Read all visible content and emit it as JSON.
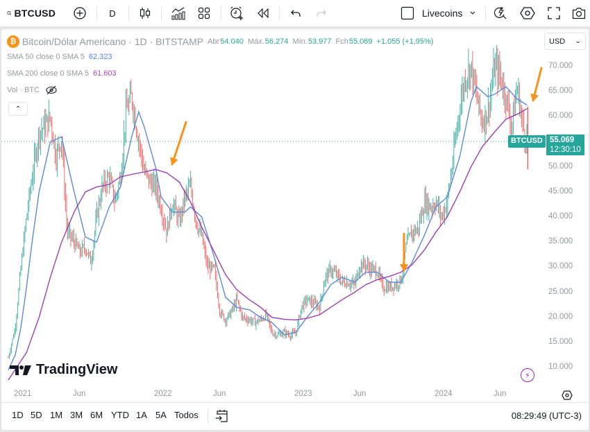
{
  "topbar": {
    "symbol": "BTCUSD",
    "interval": "D",
    "layout_name": "Livecoins",
    "icons": [
      "search-icon",
      "add-symbol-icon",
      "candles-icon",
      "indicators-icon",
      "templates-icon",
      "alert-icon",
      "replay-icon",
      "undo-icon",
      "redo-icon",
      "layout-square-icon",
      "chevron-down-icon",
      "quick-search-icon",
      "settings-icon",
      "fullscreen-icon",
      "camera-icon"
    ]
  },
  "legend": {
    "coin_glyph": "₿",
    "title": "Bitcoin/Dólar Americano · 1D · BITSTAMP",
    "open_label": "Abr",
    "open": "54.040",
    "high_label": "Máx.",
    "high": "56.274",
    "low_label": "Mín.",
    "low": "53.977",
    "close_label": "Fch",
    "close": "55.069",
    "change": "+1.055 (+1,95%)",
    "sma50_label": "SMA 50 close 0 SMA 5",
    "sma50_value": "62.323",
    "sma200_label": "SMA 200 close 0 SMA 5",
    "sma200_value": "61.603",
    "vol_label": "Vol · BTC",
    "collapse_glyph": "⌃"
  },
  "currency": {
    "label": "USD",
    "chevron": "⌄"
  },
  "price_tag": {
    "symbol": "BTCUSD",
    "price": "55.069",
    "countdown": "12:30:10"
  },
  "brand": {
    "name": "TradingView"
  },
  "bottombar": {
    "ranges": [
      "1D",
      "5D",
      "1M",
      "3M",
      "6M",
      "YTD",
      "1A",
      "5A",
      "Todos"
    ],
    "clock": "08:29:49 (UTC-3)"
  },
  "colors": {
    "up": "#26a69a",
    "down": "#ef5350",
    "sma50": "#5b8ad6",
    "sma200": "#9c3fb0",
    "arrow": "#f7931a",
    "price_line": "#26a69a"
  },
  "chart_data": {
    "type": "candlestick",
    "title": "Bitcoin/Dólar Americano · 1D · BITSTAMP",
    "y_ticks": [
      "70.000",
      "65.000",
      "60.000",
      "55.000",
      "50.000",
      "45.000",
      "40.000",
      "35.000",
      "30.000",
      "25.000",
      "20.000",
      "15.000",
      "10.000"
    ],
    "ylim": [
      8000,
      74000
    ],
    "x_ticks": [
      "2021",
      "Jun",
      "2022",
      "Jun",
      "2023",
      "Jun",
      "2024",
      "Jun"
    ],
    "x_tick_dates": [
      2021.0,
      2021.42,
      2022.0,
      2022.42,
      2023.0,
      2023.42,
      2024.0,
      2024.42
    ],
    "xlim": [
      2020.95,
      2024.72
    ],
    "current_price": 55069,
    "price_series": [
      [
        2020.95,
        12000
      ],
      [
        2021.0,
        18000
      ],
      [
        2021.04,
        30000
      ],
      [
        2021.08,
        40000
      ],
      [
        2021.12,
        48000
      ],
      [
        2021.17,
        57000
      ],
      [
        2021.21,
        58000
      ],
      [
        2021.25,
        60000
      ],
      [
        2021.29,
        52000
      ],
      [
        2021.33,
        56000
      ],
      [
        2021.37,
        37000
      ],
      [
        2021.42,
        35000
      ],
      [
        2021.46,
        33000
      ],
      [
        2021.5,
        34000
      ],
      [
        2021.54,
        31000
      ],
      [
        2021.58,
        40000
      ],
      [
        2021.62,
        46000
      ],
      [
        2021.67,
        48000
      ],
      [
        2021.71,
        43000
      ],
      [
        2021.75,
        48000
      ],
      [
        2021.79,
        61000
      ],
      [
        2021.83,
        64000
      ],
      [
        2021.87,
        57000
      ],
      [
        2021.92,
        49000
      ],
      [
        2021.96,
        47000
      ],
      [
        2022.0,
        46000
      ],
      [
        2022.04,
        42000
      ],
      [
        2022.08,
        37000
      ],
      [
        2022.12,
        43000
      ],
      [
        2022.17,
        39000
      ],
      [
        2022.21,
        44000
      ],
      [
        2022.25,
        46000
      ],
      [
        2022.29,
        39000
      ],
      [
        2022.33,
        36000
      ],
      [
        2022.37,
        30000
      ],
      [
        2022.42,
        29500
      ],
      [
        2022.46,
        21000
      ],
      [
        2022.5,
        19500
      ],
      [
        2022.54,
        21000
      ],
      [
        2022.58,
        23500
      ],
      [
        2022.62,
        20000
      ],
      [
        2022.67,
        19500
      ],
      [
        2022.71,
        19000
      ],
      [
        2022.75,
        19500
      ],
      [
        2022.79,
        20500
      ],
      [
        2022.83,
        17000
      ],
      [
        2022.87,
        16500
      ],
      [
        2022.92,
        17000
      ],
      [
        2022.96,
        16500
      ],
      [
        2023.0,
        16800
      ],
      [
        2023.04,
        22000
      ],
      [
        2023.08,
        23500
      ],
      [
        2023.12,
        23000
      ],
      [
        2023.17,
        22000
      ],
      [
        2023.21,
        28000
      ],
      [
        2023.25,
        29500
      ],
      [
        2023.29,
        28500
      ],
      [
        2023.33,
        27000
      ],
      [
        2023.37,
        27000
      ],
      [
        2023.42,
        26500
      ],
      [
        2023.46,
        30500
      ],
      [
        2023.5,
        30500
      ],
      [
        2023.54,
        29500
      ],
      [
        2023.58,
        29300
      ],
      [
        2023.62,
        26000
      ],
      [
        2023.67,
        26000
      ],
      [
        2023.71,
        26500
      ],
      [
        2023.75,
        27500
      ],
      [
        2023.79,
        34500
      ],
      [
        2023.83,
        37000
      ],
      [
        2023.87,
        37500
      ],
      [
        2023.92,
        43000
      ],
      [
        2023.96,
        42000
      ],
      [
        2024.0,
        43000
      ],
      [
        2024.04,
        40000
      ],
      [
        2024.08,
        43000
      ],
      [
        2024.12,
        51000
      ],
      [
        2024.17,
        62000
      ],
      [
        2024.21,
        68000
      ],
      [
        2024.25,
        70000
      ],
      [
        2024.29,
        64000
      ],
      [
        2024.33,
        59000
      ],
      [
        2024.37,
        61000
      ],
      [
        2024.42,
        70000
      ],
      [
        2024.46,
        68000
      ],
      [
        2024.5,
        64000
      ],
      [
        2024.54,
        58000
      ],
      [
        2024.58,
        66000
      ],
      [
        2024.62,
        58000
      ],
      [
        2024.65,
        55069
      ]
    ],
    "series": [
      {
        "name": "SMA 50",
        "last_value": 62323,
        "points": [
          [
            2020.95,
            9500
          ],
          [
            2021.0,
            12500
          ],
          [
            2021.04,
            18000
          ],
          [
            2021.08,
            26000
          ],
          [
            2021.12,
            35000
          ],
          [
            2021.17,
            45000
          ],
          [
            2021.25,
            55000
          ],
          [
            2021.33,
            56000
          ],
          [
            2021.42,
            45000
          ],
          [
            2021.5,
            36000
          ],
          [
            2021.58,
            35000
          ],
          [
            2021.67,
            42000
          ],
          [
            2021.75,
            46000
          ],
          [
            2021.83,
            56000
          ],
          [
            2021.88,
            61000
          ],
          [
            2021.92,
            58000
          ],
          [
            2022.0,
            50000
          ],
          [
            2022.04,
            44000
          ],
          [
            2022.12,
            41000
          ],
          [
            2022.21,
            41000
          ],
          [
            2022.25,
            42000
          ],
          [
            2022.33,
            40000
          ],
          [
            2022.42,
            32000
          ],
          [
            2022.5,
            24000
          ],
          [
            2022.58,
            22000
          ],
          [
            2022.67,
            21500
          ],
          [
            2022.75,
            20000
          ],
          [
            2022.83,
            19000
          ],
          [
            2022.92,
            16500
          ],
          [
            2023.0,
            17000
          ],
          [
            2023.08,
            20000
          ],
          [
            2023.17,
            23000
          ],
          [
            2023.25,
            26500
          ],
          [
            2023.33,
            28000
          ],
          [
            2023.42,
            27000
          ],
          [
            2023.5,
            29000
          ],
          [
            2023.58,
            29000
          ],
          [
            2023.67,
            27000
          ],
          [
            2023.75,
            27000
          ],
          [
            2023.83,
            31000
          ],
          [
            2023.92,
            36500
          ],
          [
            2024.0,
            42000
          ],
          [
            2024.08,
            44000
          ],
          [
            2024.17,
            52000
          ],
          [
            2024.25,
            63000
          ],
          [
            2024.29,
            66000
          ],
          [
            2024.37,
            64000
          ],
          [
            2024.42,
            64500
          ],
          [
            2024.5,
            66000
          ],
          [
            2024.58,
            63500
          ],
          [
            2024.65,
            62323
          ]
        ]
      },
      {
        "name": "SMA 200",
        "last_value": 61603,
        "points": [
          [
            2020.95,
            7500
          ],
          [
            2021.08,
            13000
          ],
          [
            2021.17,
            20000
          ],
          [
            2021.25,
            28000
          ],
          [
            2021.33,
            35000
          ],
          [
            2021.42,
            41000
          ],
          [
            2021.5,
            45000
          ],
          [
            2021.58,
            46000
          ],
          [
            2021.67,
            46500
          ],
          [
            2021.75,
            48000
          ],
          [
            2021.83,
            48500
          ],
          [
            2021.92,
            49000
          ],
          [
            2022.0,
            49500
          ],
          [
            2022.08,
            48800
          ],
          [
            2022.17,
            47000
          ],
          [
            2022.25,
            43000
          ],
          [
            2022.33,
            38000
          ],
          [
            2022.42,
            33000
          ],
          [
            2022.5,
            28500
          ],
          [
            2022.58,
            25500
          ],
          [
            2022.67,
            23500
          ],
          [
            2022.75,
            22000
          ],
          [
            2022.83,
            20000
          ],
          [
            2022.92,
            19600
          ],
          [
            2023.0,
            19500
          ],
          [
            2023.08,
            19800
          ],
          [
            2023.17,
            20500
          ],
          [
            2023.25,
            22000
          ],
          [
            2023.33,
            23500
          ],
          [
            2023.42,
            25000
          ],
          [
            2023.5,
            26500
          ],
          [
            2023.58,
            27500
          ],
          [
            2023.67,
            28200
          ],
          [
            2023.75,
            29000
          ],
          [
            2023.83,
            30500
          ],
          [
            2023.92,
            33500
          ],
          [
            2024.0,
            37000
          ],
          [
            2024.08,
            40000
          ],
          [
            2024.17,
            45000
          ],
          [
            2024.25,
            50000
          ],
          [
            2024.33,
            54000
          ],
          [
            2024.42,
            57000
          ],
          [
            2024.5,
            59500
          ],
          [
            2024.58,
            60500
          ],
          [
            2024.65,
            61603
          ]
        ]
      }
    ],
    "annotations": [
      {
        "type": "arrow",
        "date": 2022.02,
        "price": 49500,
        "direction": "down-left"
      },
      {
        "type": "arrow",
        "date": 2023.7,
        "price": 27500,
        "direction": "down"
      },
      {
        "type": "arrow",
        "date": 2024.66,
        "price": 63000,
        "direction": "down-left"
      }
    ]
  }
}
